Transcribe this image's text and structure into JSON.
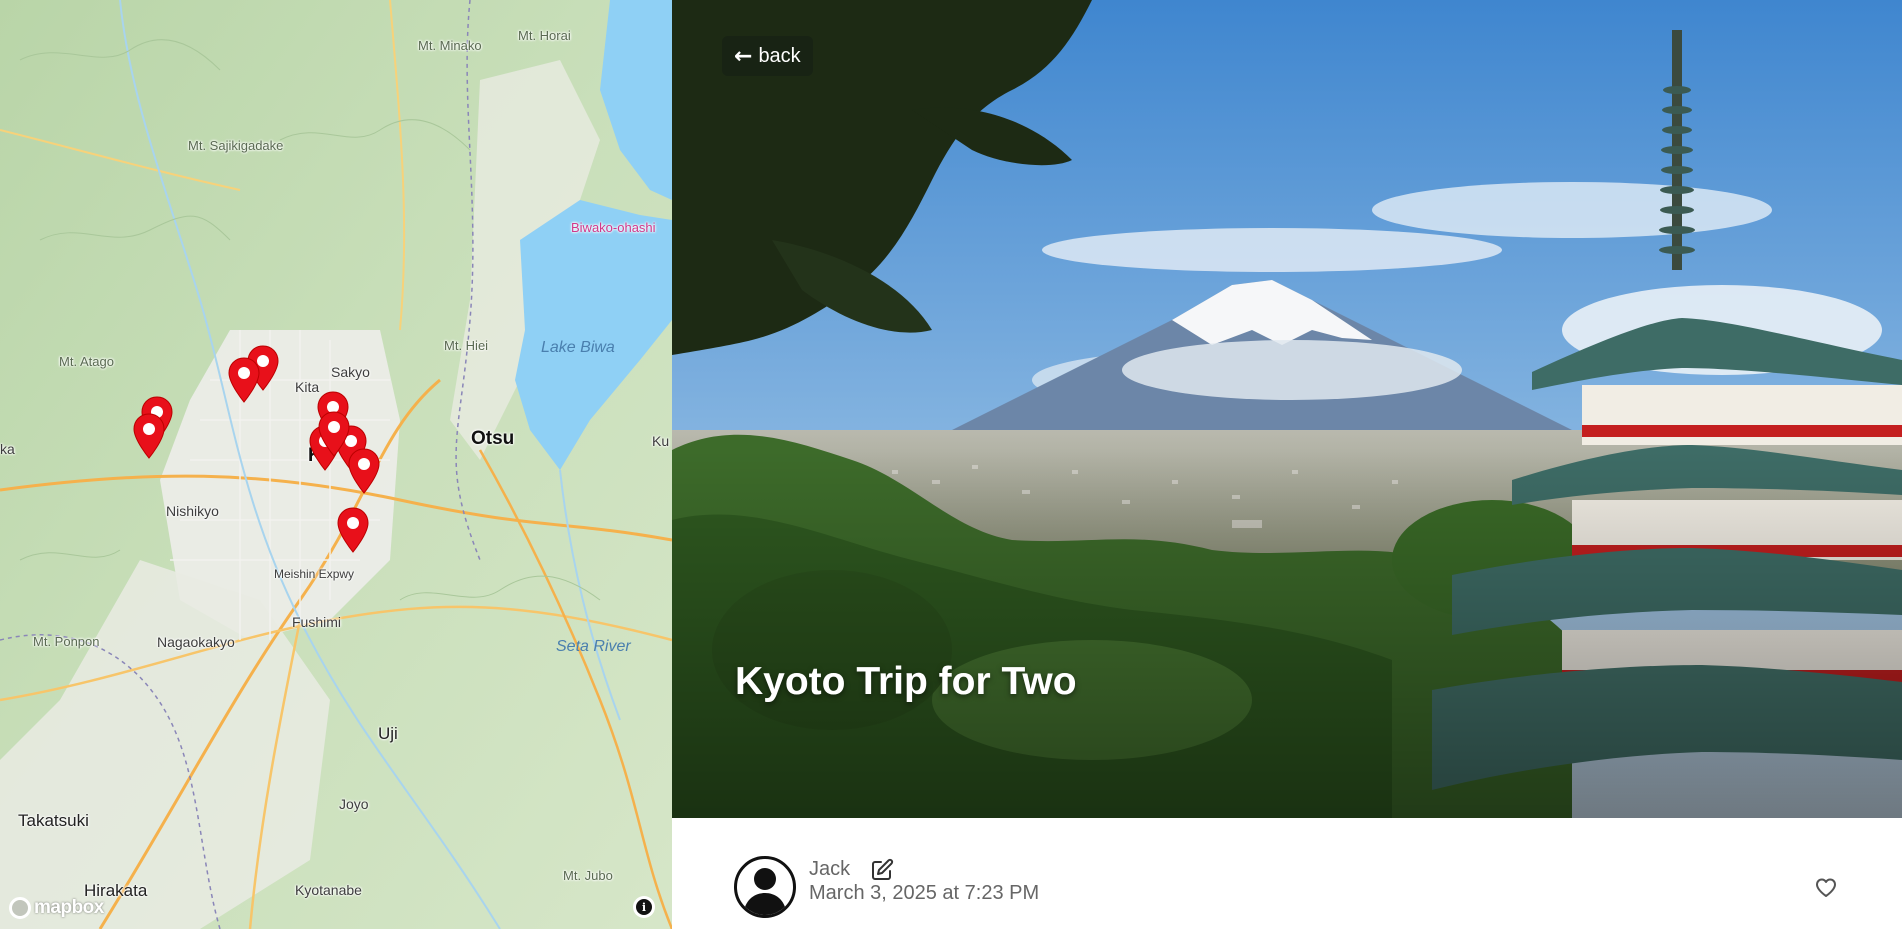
{
  "map": {
    "labels": {
      "mt_minako": "Mt. Minako",
      "mt_horai": "Mt. Horai",
      "mt_sajikigadake": "Mt. Sajikigadake",
      "biwako_ohashi": "Biwako-ohashi",
      "mt_hiei": "Mt. Hiei",
      "lake_biwa": "Lake Biwa",
      "mt_atago": "Mt. Atago",
      "sakyo": "Sakyo",
      "kita": "Kita",
      "otsu": "Otsu",
      "ku": "Ku",
      "ka": "ka",
      "nishikyo": "Nishikyo",
      "meishin_expwy": "Meishin Expwy",
      "fushimi": "Fushimi",
      "mt_ponpon": "Mt. Ponpon",
      "nagaokakyo": "Nagaokakyo",
      "seta_river": "Seta River",
      "uji": "Uji",
      "takatsuki": "Takatsuki",
      "joyo": "Joyo",
      "mt_jubo": "Mt. Jubo",
      "hirakata": "Hirakata",
      "kyotanabe": "Kyotanabe",
      "k": "K"
    },
    "marker_count": 9,
    "attribution_logo": "mapbox",
    "info_icon": "i"
  },
  "hero": {
    "back_label": "back",
    "title": "Kyoto Trip for Two"
  },
  "post": {
    "author": "Jack",
    "date": "March 3, 2025 at 7:23 PM"
  },
  "colors": {
    "marker": "#e8101a",
    "accent_text": "#666666"
  }
}
